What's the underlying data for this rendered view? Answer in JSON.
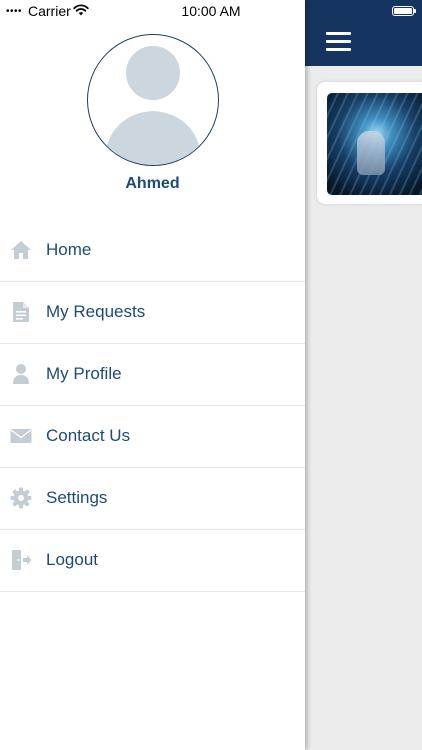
{
  "status_bar": {
    "signal": "••••",
    "carrier": "Carrier",
    "time": "10:00 AM"
  },
  "drawer": {
    "username": "Ahmed",
    "menu": [
      {
        "label": "Home",
        "icon": "home-icon"
      },
      {
        "label": "My Requests",
        "icon": "document-icon"
      },
      {
        "label": "My Profile",
        "icon": "person-icon"
      },
      {
        "label": "Contact Us",
        "icon": "envelope-icon"
      },
      {
        "label": "Settings",
        "icon": "gear-icon"
      },
      {
        "label": "Logout",
        "icon": "logout-icon"
      }
    ]
  },
  "colors": {
    "header": "#15345f",
    "text_accent": "#1e4a78",
    "icon_gray": "#c4ccd4",
    "background": "#ececec"
  }
}
